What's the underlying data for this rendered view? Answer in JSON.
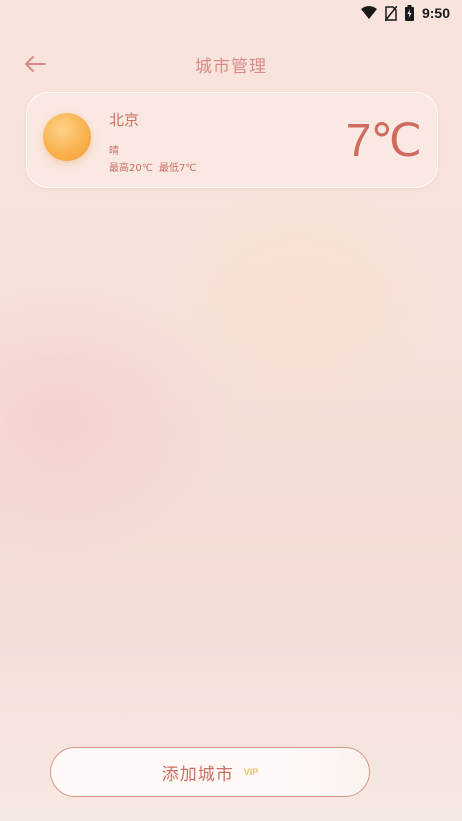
{
  "status_bar": {
    "time": "9:50",
    "icons": [
      "wifi-icon",
      "no-sim-icon",
      "battery-charging-icon"
    ]
  },
  "header": {
    "title": "城市管理",
    "back_icon": "arrow-left-icon"
  },
  "cities": [
    {
      "name": "北京",
      "weather_icon": "sun-icon",
      "weather": "晴",
      "high": "最高20℃",
      "low": "最低7℃",
      "current_temp": "7℃"
    }
  ],
  "footer": {
    "add_city_label": "添加城市",
    "vip_label": "VIP"
  },
  "colors": {
    "accent": "#d06b5f",
    "background": "#f6e2da",
    "sun": "#f9b24d",
    "vip": "#e8c17a"
  }
}
